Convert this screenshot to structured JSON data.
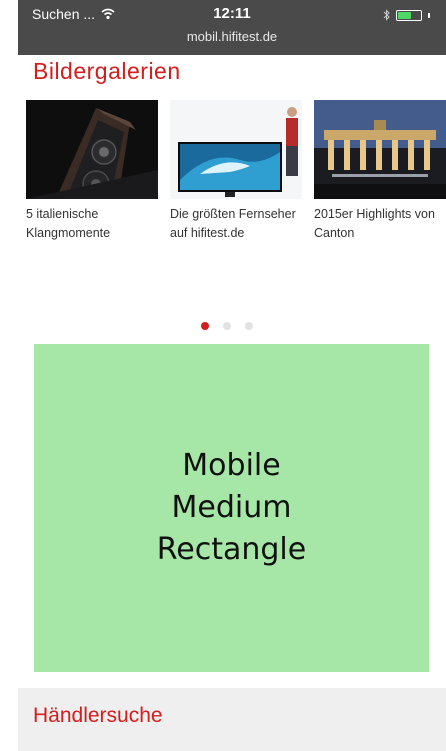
{
  "status_bar": {
    "carrier": "Suchen ...",
    "time": "12:11",
    "url": "mobil.hifitest.de",
    "battery_level": 0.6
  },
  "gallery": {
    "title": "Bildergalerien",
    "items": [
      {
        "caption": "5 italienische Klangmomente",
        "image": "speaker-photo"
      },
      {
        "caption": "Die größten Fernseher auf hifitest.de",
        "image": "tv-photo"
      },
      {
        "caption": "2015er Highlights von Canton",
        "image": "brandenburg-gate-photo"
      }
    ],
    "active_page": 1,
    "page_count": 3
  },
  "ad": {
    "lines": [
      "Mobile",
      "Medium",
      "Rectangle"
    ],
    "background_color": "#a6e6a6"
  },
  "dealer_search": {
    "title": "Händlersuche"
  },
  "colors": {
    "accent": "#d41e1e",
    "status_bar": "#4a4a4a"
  }
}
